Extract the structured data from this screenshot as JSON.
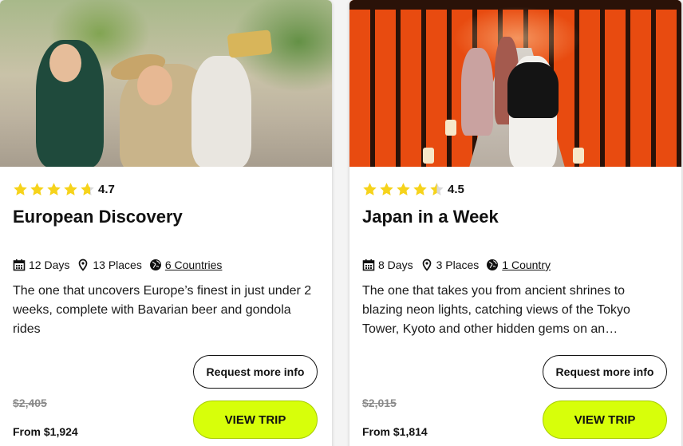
{
  "colors": {
    "accent_button": "#d7ff0a",
    "star": "#f6d31b",
    "star_empty": "#d9d9d9",
    "strike_price": "#8a8a8a"
  },
  "cards": [
    {
      "photo_icon": "group-selfie-photo",
      "rating": {
        "stars": 4.7,
        "value": "4.7"
      },
      "title": "European Discovery",
      "meta": {
        "days": "12 Days",
        "places": "13 Places",
        "countries": "6 Countries"
      },
      "description": "The one that uncovers Europe’s finest in just under 2 weeks, complete with Bavarian beer and gondola rides",
      "request_label": "Request more info",
      "old_price": "$2,405",
      "price": "From $1,924",
      "view_label": "VIEW TRIP"
    },
    {
      "photo_icon": "torii-gate-tunnel-photo",
      "rating": {
        "stars": 4.5,
        "value": "4.5"
      },
      "title": "Japan in a Week",
      "meta": {
        "days": "8 Days",
        "places": "3 Places",
        "countries": "1 Country"
      },
      "description": "The one that takes you from ancient shrines to blazing neon lights, catching views of the Tokyo Tower, Kyoto and other hidden gems on an…",
      "request_label": "Request more info",
      "old_price": "$2,015",
      "price": "From $1,814",
      "view_label": "VIEW TRIP"
    }
  ]
}
